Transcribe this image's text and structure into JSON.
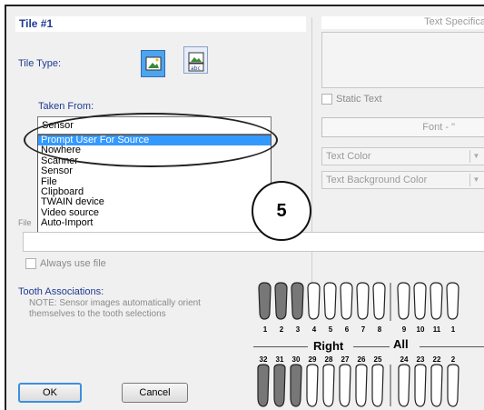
{
  "dialog": {
    "title": "Tile #1",
    "tile_type_label": "Tile Type:",
    "taken_from_label": "Taken From:",
    "taken_from_value": "Sensor",
    "options": [
      "Prompt User For Source",
      "Nowhere",
      "Scanner",
      "Sensor",
      "File",
      "Clipboard",
      "TWAIN device",
      "Video source",
      "Auto-Import"
    ],
    "selected_option": "Prompt User For Source",
    "file_label": "File",
    "always_use_file": "Always use file",
    "tooth_assoc_label": "Tooth Associations:",
    "note": "NOTE:  Sensor images automatically orient themselves to the tooth selections",
    "ok_label": "OK",
    "cancel_label": "Cancel"
  },
  "text_spec": {
    "header": "Text Specificat",
    "static_text": "Static Text",
    "font_button": "Font - \"",
    "text_color": "Text Color",
    "text_bg_color": "Text Background Color"
  },
  "teeth": {
    "upper_numbers": [
      "1",
      "2",
      "3",
      "4",
      "5",
      "6",
      "7",
      "8",
      "9",
      "10",
      "11",
      "1"
    ],
    "lower_numbers": [
      "32",
      "31",
      "30",
      "29",
      "28",
      "27",
      "26",
      "25",
      "24",
      "23",
      "22",
      "2"
    ],
    "right_label": "Right",
    "all_label": "All"
  },
  "callout": {
    "number": "5"
  }
}
